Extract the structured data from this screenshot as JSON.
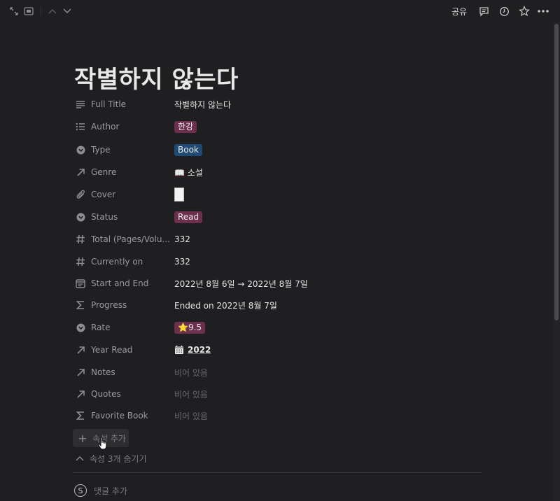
{
  "topbar": {
    "share_label": "공유",
    "icons": [
      "expand-icon",
      "layout-icon",
      "chevron-up-icon",
      "chevron-down-icon",
      "comment-icon",
      "history-icon",
      "star-icon",
      "more-icon"
    ]
  },
  "page": {
    "title": "작별하지 않는다"
  },
  "properties": [
    {
      "name": "Full Title",
      "icon": "text-icon",
      "value": "작별하지 않는다"
    },
    {
      "name": "Author",
      "icon": "list-icon",
      "value": "한강"
    },
    {
      "name": "Type",
      "icon": "select-icon",
      "value": "Book"
    },
    {
      "name": "Genre",
      "icon": "relation-icon",
      "value": "📖 소설"
    },
    {
      "name": "Cover",
      "icon": "attachment-icon",
      "value": ""
    },
    {
      "name": "Status",
      "icon": "select-icon",
      "value": "Read"
    },
    {
      "name": "Total (Pages/Volu...",
      "icon": "number-icon",
      "value": "332"
    },
    {
      "name": "Currently on",
      "icon": "number-icon",
      "value": "332"
    },
    {
      "name": "Start and End",
      "icon": "date-icon",
      "value": "2022년 8월 6일 → 2022년 8월 7일"
    },
    {
      "name": "Progress",
      "icon": "formula-icon",
      "value": "Ended on 2022년 8월 7일"
    },
    {
      "name": "Rate",
      "icon": "select-icon",
      "value": "⭐9.5"
    },
    {
      "name": "Year Read",
      "icon": "relation-icon",
      "value": "2022"
    },
    {
      "name": "Notes",
      "icon": "relation-icon",
      "value": "비어 있음"
    },
    {
      "name": "Quotes",
      "icon": "relation-icon",
      "value": "비어 있음"
    },
    {
      "name": "Favorite Book",
      "icon": "formula-icon",
      "value": "비어 있음"
    }
  ],
  "actions": {
    "add_property": "속성 추가",
    "hide_properties": "속성 3개 숨기기",
    "add_comment": "댓글 추가",
    "avatar_letter": "S"
  },
  "colors": {
    "background": "#1f1e21",
    "tag_pink": "#6c2f4d",
    "tag_blue": "#1e4a73"
  }
}
